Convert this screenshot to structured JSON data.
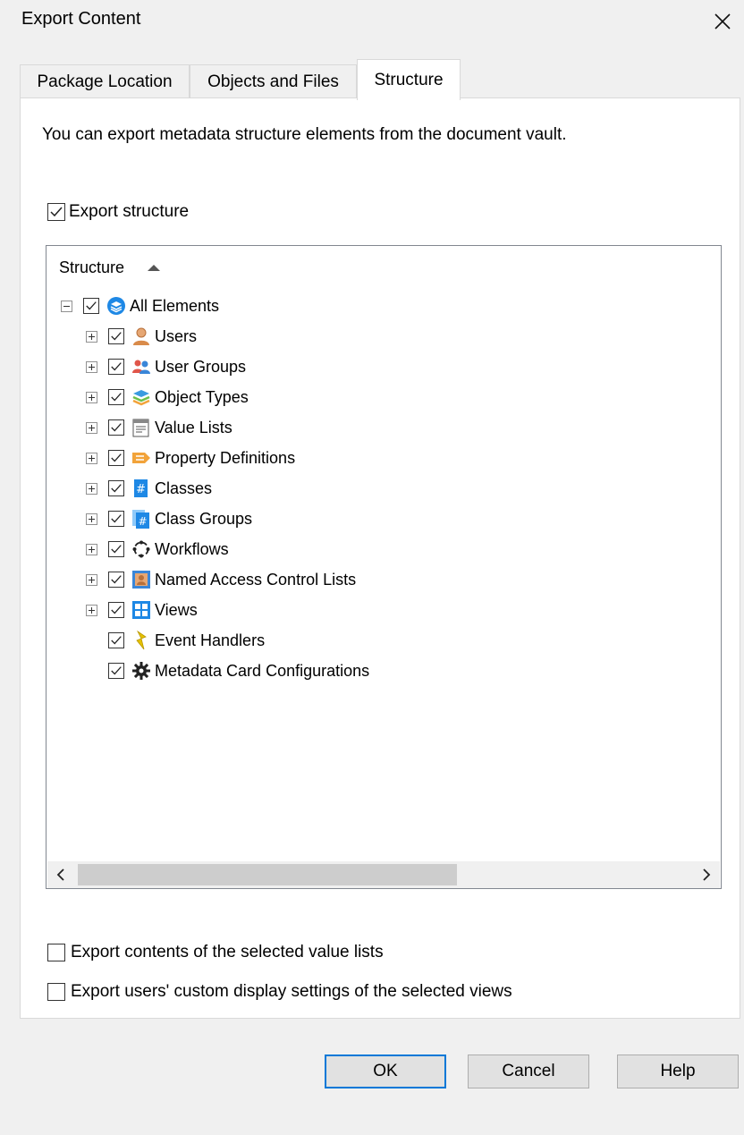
{
  "window": {
    "title": "Export Content"
  },
  "tabs": [
    {
      "label": "Package Location"
    },
    {
      "label": "Objects and Files"
    },
    {
      "label": "Structure"
    }
  ],
  "panel": {
    "intro": "You can export metadata structure elements from the document vault.",
    "export_structure": {
      "label": "Export structure",
      "checked": true
    },
    "tree": {
      "column_header": "Structure",
      "root": {
        "label": "All Elements",
        "checked": true,
        "expanded": true,
        "icon": "stack-icon"
      },
      "children": [
        {
          "label": "Users",
          "checked": true,
          "expandable": true,
          "icon": "user-icon"
        },
        {
          "label": "User Groups",
          "checked": true,
          "expandable": true,
          "icon": "user-group-icon"
        },
        {
          "label": "Object Types",
          "checked": true,
          "expandable": true,
          "icon": "object-types-icon"
        },
        {
          "label": "Value Lists",
          "checked": true,
          "expandable": true,
          "icon": "value-list-icon"
        },
        {
          "label": "Property Definitions",
          "checked": true,
          "expandable": true,
          "icon": "property-def-icon"
        },
        {
          "label": "Classes",
          "checked": true,
          "expandable": true,
          "icon": "class-icon"
        },
        {
          "label": "Class Groups",
          "checked": true,
          "expandable": true,
          "icon": "class-group-icon"
        },
        {
          "label": "Workflows",
          "checked": true,
          "expandable": true,
          "icon": "workflow-icon"
        },
        {
          "label": "Named Access Control Lists",
          "checked": true,
          "expandable": true,
          "icon": "acl-icon"
        },
        {
          "label": "Views",
          "checked": true,
          "expandable": true,
          "icon": "views-icon"
        },
        {
          "label": "Event Handlers",
          "checked": true,
          "expandable": false,
          "icon": "event-handler-icon"
        },
        {
          "label": "Metadata Card Configurations",
          "checked": true,
          "expandable": false,
          "icon": "gear-icon"
        }
      ]
    },
    "export_value_lists": {
      "label": "Export contents of the selected value lists",
      "checked": false
    },
    "export_custom_display": {
      "label": "Export users' custom display settings of the selected views",
      "checked": false
    }
  },
  "buttons": {
    "ok": "OK",
    "cancel": "Cancel",
    "help": "Help"
  },
  "colors": {
    "accent": "#0078d7",
    "user_orange": "#d98b4a",
    "class_blue": "#1e88e5",
    "event_yellow": "#e6c200"
  }
}
